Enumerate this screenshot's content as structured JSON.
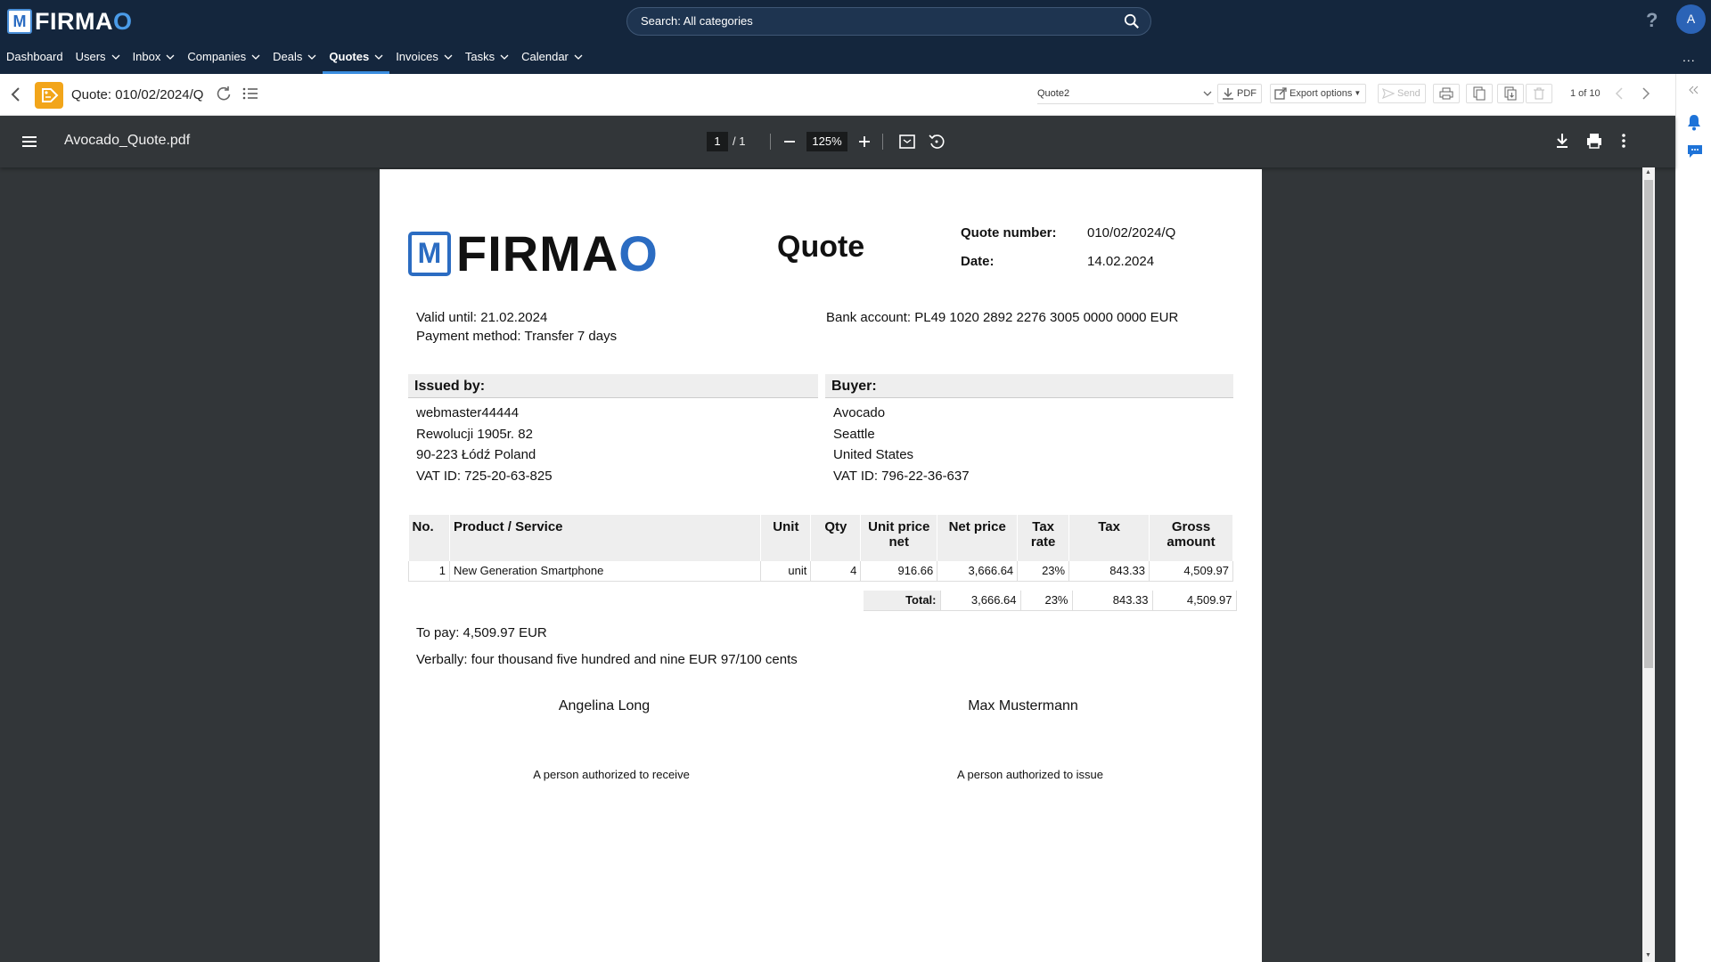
{
  "app": {
    "logo_text": "FIRMA",
    "logo_o": "O",
    "search_placeholder": "Search: All categories",
    "help": "?",
    "avatar": "A",
    "nav_more": "...",
    "nav": [
      {
        "label": "Dashboard",
        "dropdown": false
      },
      {
        "label": "Users",
        "dropdown": true
      },
      {
        "label": "Inbox",
        "dropdown": true
      },
      {
        "label": "Companies",
        "dropdown": true
      },
      {
        "label": "Deals",
        "dropdown": true
      },
      {
        "label": "Quotes",
        "dropdown": true,
        "active": true
      },
      {
        "label": "Invoices",
        "dropdown": true
      },
      {
        "label": "Tasks",
        "dropdown": true
      },
      {
        "label": "Calendar",
        "dropdown": true
      }
    ]
  },
  "toolbar": {
    "title": "Quote: 010/02/2024/Q",
    "template": "Quote2",
    "pdf": "PDF",
    "export": "Export options",
    "send": "Send",
    "pager": "1 of 10"
  },
  "viewer": {
    "filename": "Avocado_Quote.pdf",
    "page_current": "1",
    "page_total": "/   1",
    "zoom": "125%"
  },
  "doc": {
    "logo_text": "FIRMA",
    "logo_o": "O",
    "title": "Quote",
    "quote_number_label": "Quote number:",
    "quote_number": "010/02/2024/Q",
    "date_label": "Date:",
    "date": "14.02.2024",
    "valid_until": "Valid until: 21.02.2024",
    "payment_method": "Payment method: Transfer 7 days",
    "bank_account": "Bank account: PL49 1020 2892 2276 3005 0000 0000  EUR",
    "issued_by_label": "Issued by:",
    "issued_by": [
      "webmaster44444",
      "Rewolucji 1905r. 82",
      "90-223 Łódź Poland",
      "VAT ID: 725-20-63-825"
    ],
    "buyer_label": "Buyer:",
    "buyer": [
      "Avocado",
      "Seattle",
      "United States",
      "VAT ID:  796-22-36-637"
    ],
    "table_headers": [
      "No.",
      "Product / Service",
      "Unit",
      "Qty",
      "Unit price net",
      "Net price",
      "Tax rate",
      "Tax",
      "Gross amount"
    ],
    "items": [
      {
        "no": "1",
        "product": "New Generation Smartphone",
        "unit": "unit",
        "qty": "4",
        "unit_price": "916.66",
        "net": "3,666.64",
        "rate": "23%",
        "tax": "843.33",
        "gross": "4,509.97"
      }
    ],
    "totals": {
      "label": "Total:",
      "net": "3,666.64",
      "rate": "23%",
      "tax": "843.33",
      "gross": "4,509.97"
    },
    "to_pay": "To pay: 4,509.97 EUR",
    "verbally": "Verbally: four thousand five hundred and nine EUR 97/100 cents",
    "signature_left_name": "Angelina Long",
    "signature_left_role": "A person authorized  to receive",
    "signature_right_name": "Max Mustermann",
    "signature_right_role": "A person authorized  to issue"
  },
  "colors": {
    "header_bg": "#14263d",
    "accent": "#3a8ddf",
    "quote_badge": "#f2a51a",
    "viewer_bg": "#323639"
  }
}
